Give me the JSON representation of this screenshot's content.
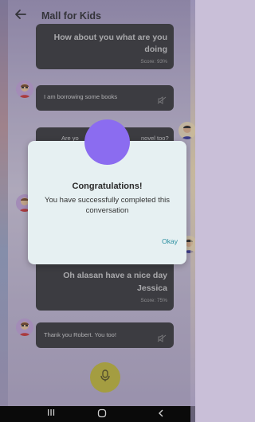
{
  "header": {
    "back_icon": "arrow-left-icon",
    "title": "Mall for Kids"
  },
  "messages": [
    {
      "text": "How about you what are you doing",
      "score": "Score: 93%"
    },
    {
      "text": "I am borrowing some books"
    },
    {
      "text_left": "Are yo",
      "text_right": "novel too?"
    },
    {
      "text": "Oh alasan have a nice day Jessica",
      "score": "Score: 75%"
    },
    {
      "text": "Thank you Robert. You too!"
    }
  ],
  "dialog": {
    "title": "Congratulations!",
    "message": "You have successfully completed this conversation",
    "ok_label": "Okay"
  },
  "mic_icon": "microphone-icon",
  "colors": {
    "bubble": "#3a3a3c",
    "dialog_bg": "#e6f0f2",
    "accent_purple": "#8b6cf0",
    "mic_yellow": "#c9bf3c",
    "ok_teal": "#2a8fa0"
  }
}
